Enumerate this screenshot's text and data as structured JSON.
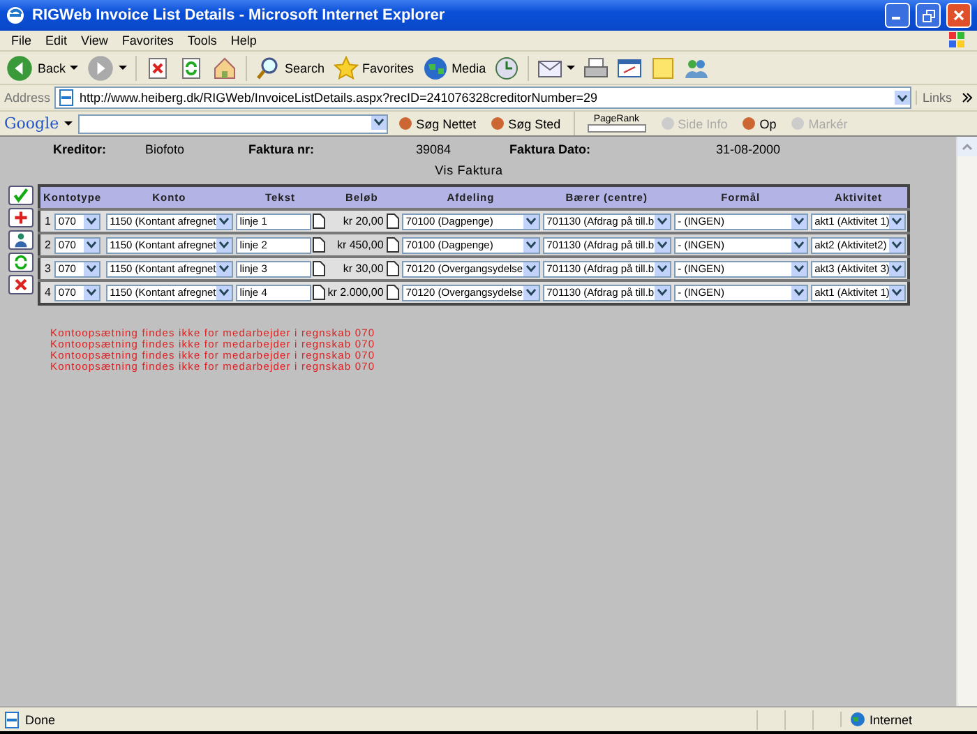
{
  "window": {
    "title": "RIGWeb Invoice List Details - Microsoft Internet Explorer"
  },
  "menu": [
    "File",
    "Edit",
    "View",
    "Favorites",
    "Tools",
    "Help"
  ],
  "toolbar": [
    {
      "kind": "back",
      "label": "Back"
    },
    {
      "kind": "forward"
    },
    {
      "kind": "stop"
    },
    {
      "kind": "refresh"
    },
    {
      "kind": "home"
    },
    {
      "kind": "search",
      "label": "Search"
    },
    {
      "kind": "favorites",
      "label": "Favorites"
    },
    {
      "kind": "media",
      "label": "Media"
    },
    {
      "kind": "history"
    },
    {
      "kind": "mail"
    },
    {
      "kind": "print"
    },
    {
      "kind": "edit"
    },
    {
      "kind": "discuss"
    },
    {
      "kind": "messenger"
    }
  ],
  "address": {
    "label": "Address",
    "url": "http://www.heiberg.dk/RIGWeb/InvoiceListDetails.aspx?recID=241076328creditorNumber=29",
    "links": "Links"
  },
  "google_bar": {
    "logo": "Google",
    "items": [
      {
        "kind": "button",
        "label": "Søg Nettet",
        "disabled": false
      },
      {
        "kind": "button",
        "label": "Søg Sted",
        "disabled": false
      },
      {
        "kind": "pagerank",
        "label": "PageRank",
        "disabled": false
      },
      {
        "kind": "button",
        "label": "Side Info",
        "disabled": true
      },
      {
        "kind": "button",
        "label": "Op",
        "disabled": false
      },
      {
        "kind": "button",
        "label": "Markér",
        "disabled": true
      }
    ]
  },
  "invoice": {
    "fields": [
      {
        "label": "Kreditor:",
        "value": "Biofoto"
      },
      {
        "label": "Faktura nr:",
        "value": "39084"
      },
      {
        "label": "Faktura Dato:",
        "value": "31-08-2000"
      }
    ],
    "subtitle": "Vis Faktura"
  },
  "actions": [
    {
      "kind": "approve"
    },
    {
      "kind": "add"
    },
    {
      "kind": "user"
    },
    {
      "kind": "refresh"
    },
    {
      "kind": "delete"
    }
  ],
  "table": {
    "columns": [
      "Kontotype",
      "Konto",
      "Tekst",
      "Beløb",
      "Afdeling",
      "Bærer (centre)",
      "Formål",
      "Aktivitet"
    ],
    "rows": [
      {
        "number": "1",
        "kontotype": "070",
        "konto": "1150 (Kontant afregnet",
        "tekst": "linje 1",
        "beloeb": "kr 20,00",
        "afdeling": "70100 (Dagpenge)",
        "baerer": "701130 (Afdrag på till.b",
        "formaal": "- (INGEN)",
        "aktivitet": "akt1 (Aktivitet 1)"
      },
      {
        "number": "2",
        "kontotype": "070",
        "konto": "1150 (Kontant afregnet",
        "tekst": "linje 2",
        "beloeb": "kr 450,00",
        "afdeling": "70100 (Dagpenge)",
        "baerer": "701130 (Afdrag på till.b",
        "formaal": "- (INGEN)",
        "aktivitet": "akt2 (Aktivitet2)"
      },
      {
        "number": "3",
        "kontotype": "070",
        "konto": "1150 (Kontant afregnet",
        "tekst": "linje 3",
        "beloeb": "kr 30,00",
        "afdeling": "70120 (Overgangsydelse",
        "baerer": "701130 (Afdrag på till.b",
        "formaal": "- (INGEN)",
        "aktivitet": "akt3 (Aktivitet 3)"
      },
      {
        "number": "4",
        "kontotype": "070",
        "konto": "1150 (Kontant afregnet",
        "tekst": "linje 4",
        "beloeb": "kr 2.000,00",
        "afdeling": "70120 (Overgangsydelse",
        "baerer": "701130 (Afdrag på till.b",
        "formaal": "- (INGEN)",
        "aktivitet": "akt1 (Aktivitet 1)"
      }
    ]
  },
  "errors": [
    "Kontoopsætning findes ikke for medarbejder i regnskab 070",
    "Kontoopsætning findes ikke for medarbejder i regnskab 070",
    "Kontoopsætning findes ikke for medarbejder i regnskab 070",
    "Kontoopsætning findes ikke for medarbejder i regnskab 070"
  ],
  "status_bar": {
    "text": "Done",
    "zone": "Internet"
  }
}
